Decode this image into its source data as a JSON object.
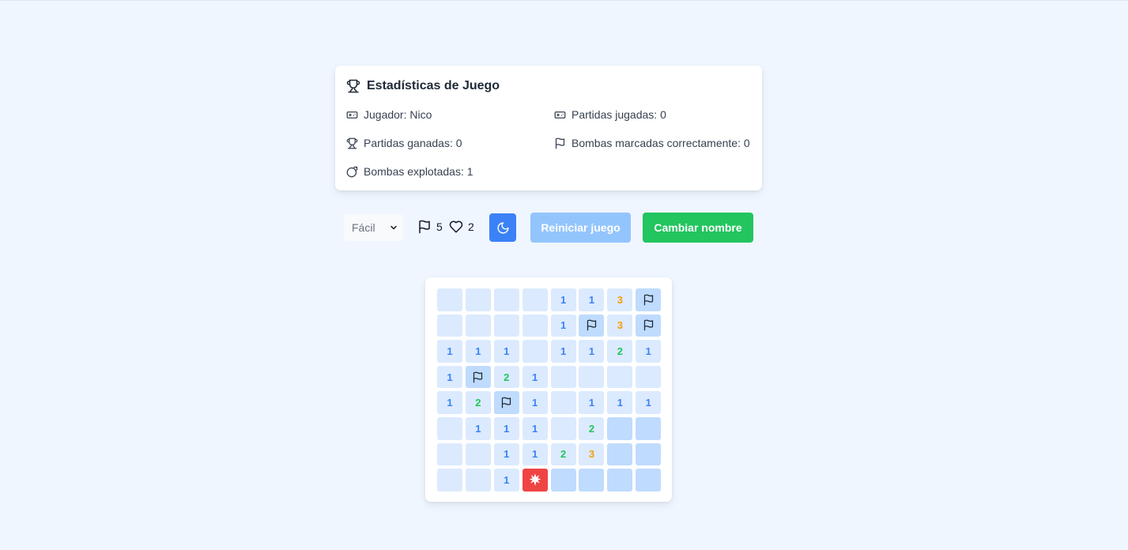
{
  "stats": {
    "title": "Estadísticas de Juego",
    "player": "Jugador: Nico",
    "played": "Partidas jugadas: 0",
    "won": "Partidas ganadas: 0",
    "flagged_correct": "Bombas marcadas correctamente: 0",
    "exploded": "Bombas explotadas: 1"
  },
  "controls": {
    "difficulty": "Fácil",
    "flags_left": "5",
    "lives": "2",
    "restart_label": "Reiniciar juego",
    "change_name_label": "Cambiar nombre"
  },
  "colors": {
    "background": "#eff6ff",
    "primary": "#3b82f6",
    "restart_disabled": "#93c5fd",
    "success": "#22c55e",
    "mine": "#ef4444",
    "cell_revealed": "#dbeafe",
    "cell_hidden": "#bfdbfe"
  },
  "board": {
    "rows": [
      [
        "",
        "",
        "",
        "",
        "1",
        "1",
        "3",
        "F"
      ],
      [
        "",
        "",
        "",
        "",
        "1",
        "F",
        "3",
        "F"
      ],
      [
        "1",
        "1",
        "1",
        "",
        "1",
        "1",
        "2",
        "1"
      ],
      [
        "1",
        "F",
        "2",
        "1",
        "",
        "",
        "",
        ""
      ],
      [
        "1",
        "2",
        "F",
        "1",
        "",
        "1",
        "1",
        "1"
      ],
      [
        "",
        "1",
        "1",
        "1",
        "",
        "2",
        "H",
        "H"
      ],
      [
        "",
        "",
        "1",
        "1",
        "2",
        "3",
        "H",
        "H"
      ],
      [
        "",
        "",
        "1",
        "X",
        "H",
        "H",
        "H",
        "H"
      ]
    ],
    "legend": {
      "F": "flag-icon",
      "H": "hidden-cell",
      "X": "exploded-mine-icon"
    }
  }
}
